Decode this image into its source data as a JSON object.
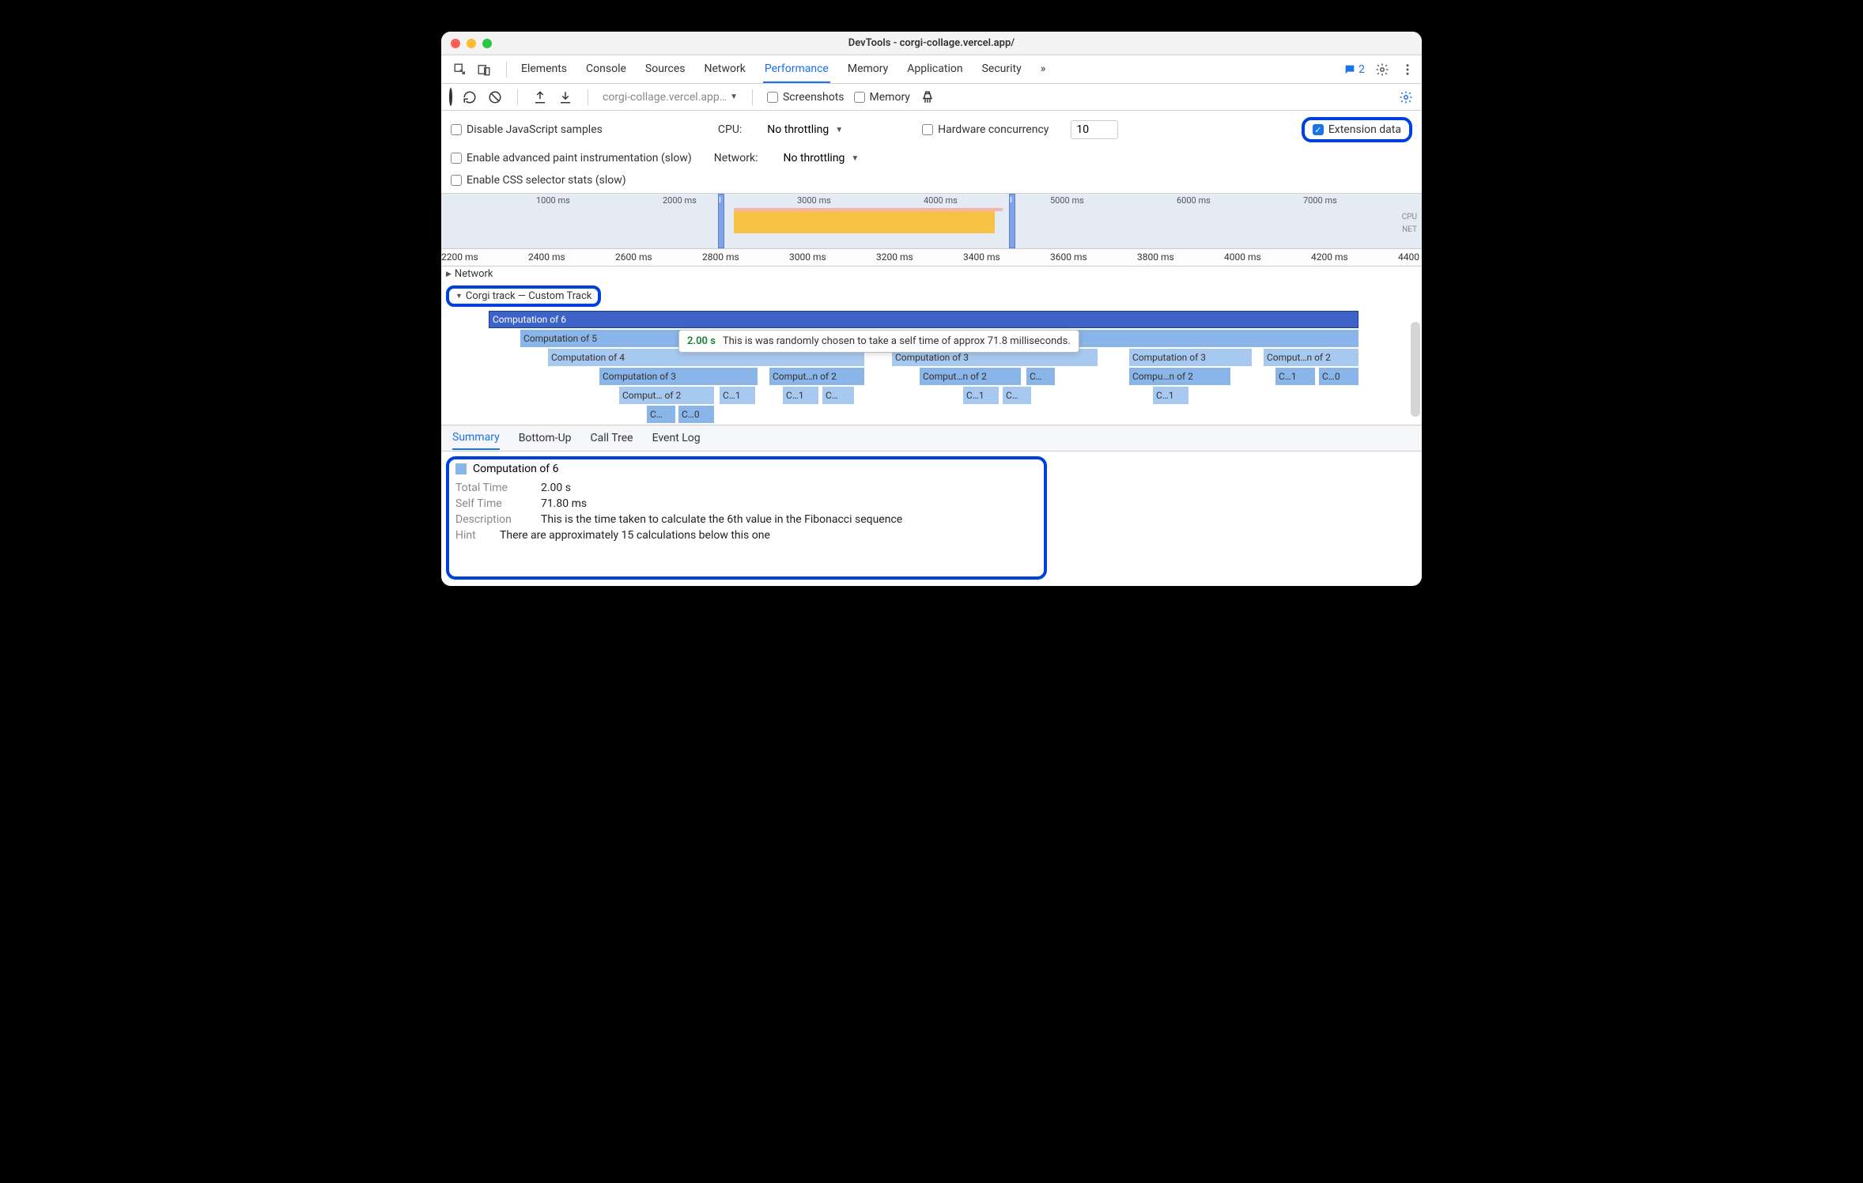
{
  "window": {
    "title": "DevTools - corgi-collage.vercel.app/"
  },
  "tabs": {
    "items": [
      "Elements",
      "Console",
      "Sources",
      "Network",
      "Performance",
      "Memory",
      "Application",
      "Security"
    ],
    "active": "Performance",
    "overflow_glyph": "»",
    "issue_count": "2"
  },
  "toolbar": {
    "url": "corgi-collage.vercel.app…",
    "screenshots_label": "Screenshots",
    "memory_label": "Memory"
  },
  "settings": {
    "disable_js_samples": "Disable JavaScript samples",
    "cpu_label": "CPU:",
    "cpu_value": "No throttling",
    "hw_conc_label": "Hardware concurrency",
    "hw_conc_value": "10",
    "extension_data_label": "Extension data",
    "adv_paint": "Enable advanced paint instrumentation (slow)",
    "net_label": "Network:",
    "net_value": "No throttling",
    "css_stats": "Enable CSS selector stats (slow)"
  },
  "overview": {
    "ticks": [
      "1000 ms",
      "2000 ms",
      "3000 ms",
      "4000 ms",
      "5000 ms",
      "6000 ms",
      "7000 ms"
    ],
    "right_labels": {
      "cpu": "CPU",
      "net": "NET"
    }
  },
  "ruler": {
    "ticks": [
      "2200 ms",
      "2400 ms",
      "2600 ms",
      "2800 ms",
      "3000 ms",
      "3200 ms",
      "3400 ms",
      "3600 ms",
      "3800 ms",
      "4000 ms",
      "4200 ms",
      "4400"
    ]
  },
  "tracks": {
    "network": "Network",
    "corgi": "Corgi track — Custom Track"
  },
  "flame": {
    "row0": {
      "c6": "Computation of 6"
    },
    "row1": {
      "c5": "Computation of 5"
    },
    "row2": {
      "c4a": "Computation of 4",
      "c3b": "Computation of 3",
      "c3c": "Computation of 3",
      "c2d": "Comput…n of 2"
    },
    "row3": {
      "c3a": "Computation of 3",
      "c2a": "Comput…n of 2",
      "c2b": "Comput…n of 2",
      "c_s1": "C…",
      "c2c": "Compu…n of 2",
      "c1x": "C…1",
      "c0x": "C…0"
    },
    "row4": {
      "c2": "Comput… of 2",
      "c1a": "C…1",
      "c1b": "C…1",
      "c_s2": "C…",
      "c1c": "C…1",
      "c_s3": "C…",
      "c1d": "C…1"
    },
    "row5": {
      "c_s4": "C…",
      "c0": "C…0"
    }
  },
  "tooltip": {
    "time": "2.00 s",
    "text": "This is was randomly chosen to take a self time of approx 71.8 milliseconds."
  },
  "detail_tabs": {
    "items": [
      "Summary",
      "Bottom-Up",
      "Call Tree",
      "Event Log"
    ],
    "active": "Summary"
  },
  "summary": {
    "title": "Computation of 6",
    "rows": {
      "total_time": {
        "label": "Total Time",
        "value": "2.00 s"
      },
      "self_time": {
        "label": "Self Time",
        "value": "71.80 ms"
      },
      "description": {
        "label": "Description",
        "value": "This is the time taken to calculate the 6th value in the Fibonacci sequence"
      },
      "hint": {
        "label": "Hint",
        "value": "There are approximately 15 calculations below this one"
      }
    }
  }
}
